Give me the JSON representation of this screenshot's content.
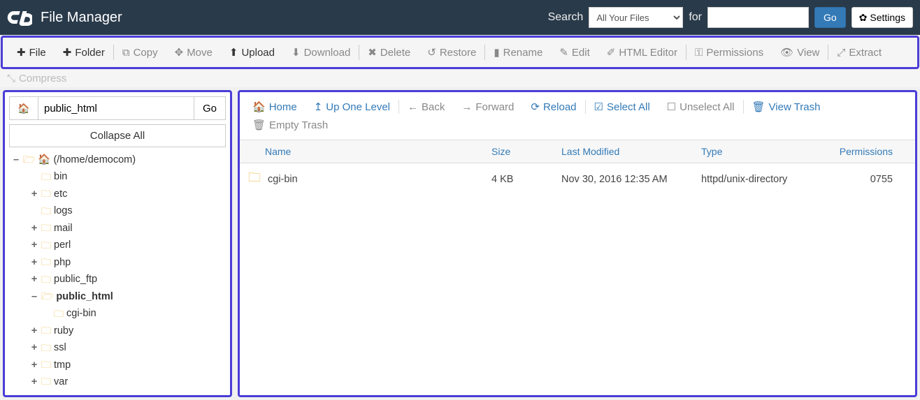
{
  "header": {
    "title": "File Manager",
    "search_label": "Search",
    "search_scope": "All Your Files",
    "for_label": "for",
    "search_value": "",
    "go": "Go",
    "settings": "Settings"
  },
  "toolbar": {
    "file": "File",
    "folder": "Folder",
    "copy": "Copy",
    "move": "Move",
    "upload": "Upload",
    "download": "Download",
    "delete": "Delete",
    "restore": "Restore",
    "rename": "Rename",
    "edit": "Edit",
    "html_editor": "HTML Editor",
    "permissions": "Permissions",
    "view": "View",
    "extract": "Extract",
    "compress": "Compress"
  },
  "sidebar": {
    "path_value": "public_html",
    "go": "Go",
    "collapse_all": "Collapse All",
    "root_label": "(/home/democom)",
    "nodes": [
      {
        "label": "bin",
        "toggle": "",
        "level": 1
      },
      {
        "label": "etc",
        "toggle": "+",
        "level": 1
      },
      {
        "label": "logs",
        "toggle": "",
        "level": 1
      },
      {
        "label": "mail",
        "toggle": "+",
        "level": 1
      },
      {
        "label": "perl",
        "toggle": "+",
        "level": 1
      },
      {
        "label": "php",
        "toggle": "+",
        "level": 1
      },
      {
        "label": "public_ftp",
        "toggle": "+",
        "level": 1
      },
      {
        "label": "public_html",
        "toggle": "–",
        "level": 1,
        "selected": true
      },
      {
        "label": "cgi-bin",
        "toggle": "",
        "level": 2
      },
      {
        "label": "ruby",
        "toggle": "+",
        "level": 1
      },
      {
        "label": "ssl",
        "toggle": "+",
        "level": 1
      },
      {
        "label": "tmp",
        "toggle": "+",
        "level": 1
      },
      {
        "label": "var",
        "toggle": "+",
        "level": 1
      }
    ]
  },
  "nav": {
    "home": "Home",
    "up": "Up One Level",
    "back": "Back",
    "forward": "Forward",
    "reload": "Reload",
    "select_all": "Select All",
    "unselect_all": "Unselect All",
    "view_trash": "View Trash",
    "empty_trash": "Empty Trash"
  },
  "columns": {
    "name": "Name",
    "size": "Size",
    "modified": "Last Modified",
    "type": "Type",
    "permissions": "Permissions"
  },
  "rows": [
    {
      "name": "cgi-bin",
      "size": "4 KB",
      "modified": "Nov 30, 2016 12:35 AM",
      "type": "httpd/unix-directory",
      "permissions": "0755"
    }
  ]
}
